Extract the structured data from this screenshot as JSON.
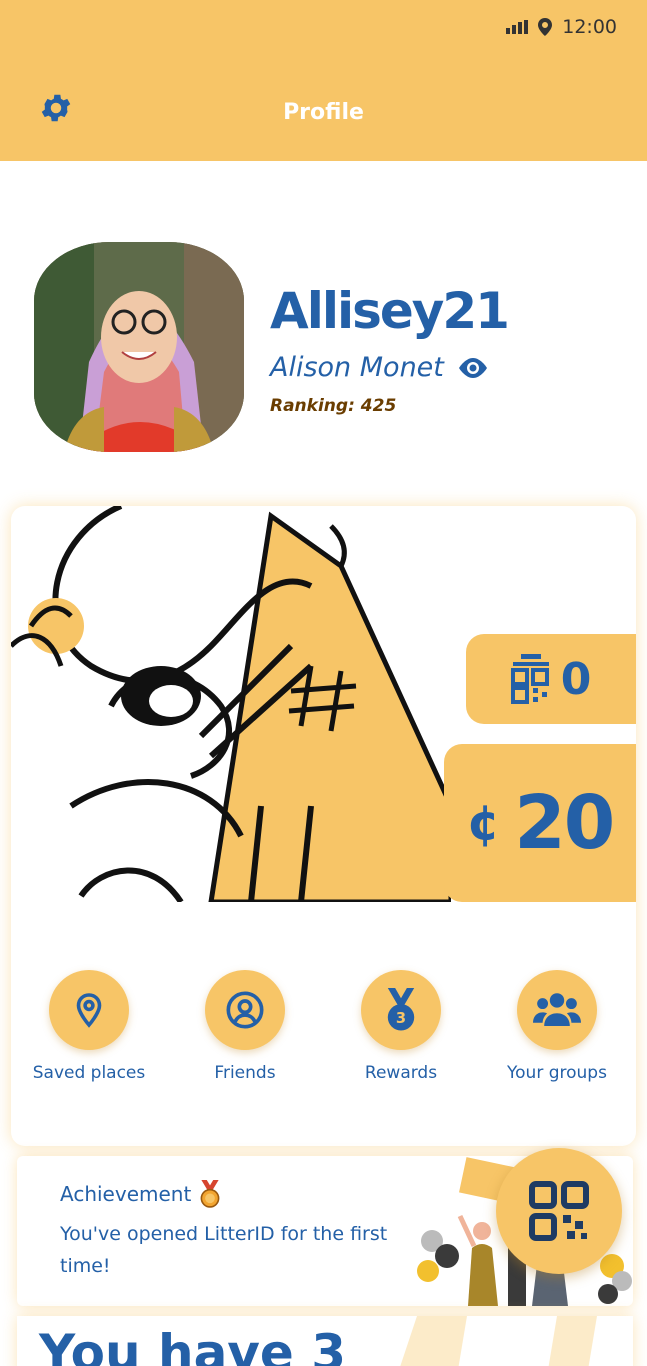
{
  "status_bar": {
    "time": "12:00"
  },
  "header": {
    "title": "Profile",
    "settings_icon": "gear-icon"
  },
  "profile": {
    "username": "Allisey21",
    "full_name": "Alison Monet",
    "ranking": "Ranking: 425",
    "visibility_icon": "eye-icon"
  },
  "stats": {
    "qr_scans": "0",
    "coins_symbol": "¢",
    "coins": "20"
  },
  "actions": [
    {
      "label": "Saved places",
      "icon": "location-pin-icon"
    },
    {
      "label": "Friends",
      "icon": "user-circle-icon"
    },
    {
      "label": "Rewards",
      "icon": "medal-icon"
    },
    {
      "label": "Your groups",
      "icon": "users-group-icon"
    }
  ],
  "achievement": {
    "title": "Achievement",
    "text": "You've opened LitterID for the first time!"
  },
  "next_card": {
    "heading": "You have 3"
  },
  "colors": {
    "accent": "#f7c567",
    "brand": "#2460a7",
    "ranking": "#6a3d00"
  }
}
